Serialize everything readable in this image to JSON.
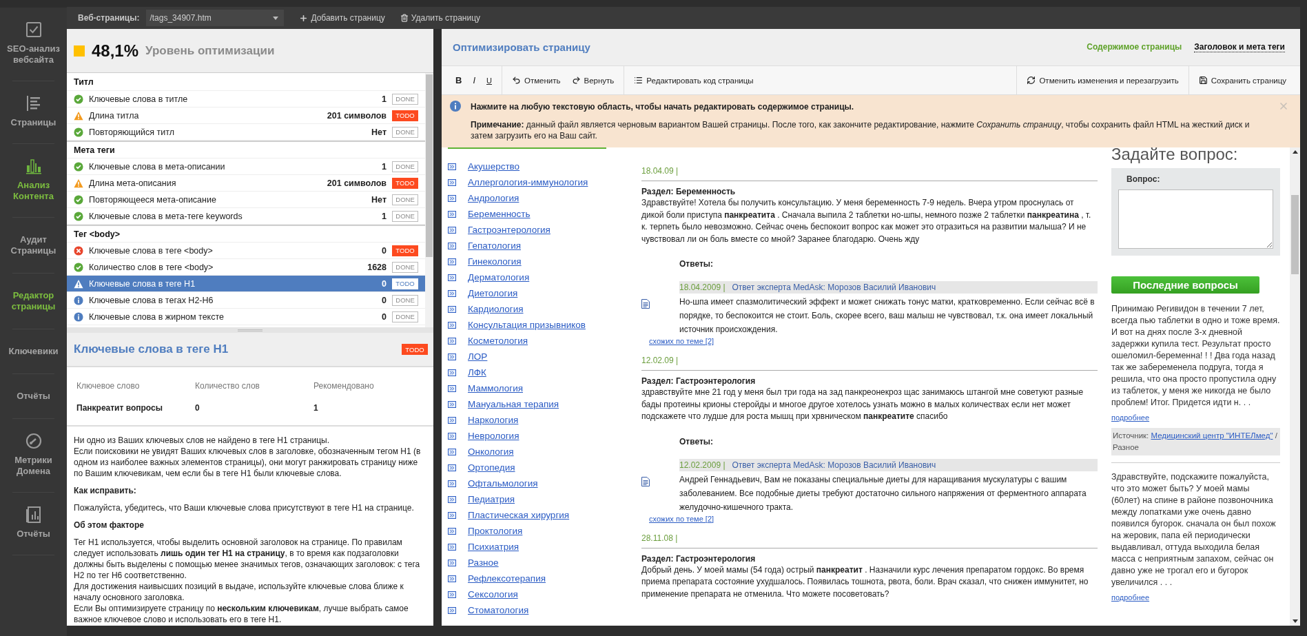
{
  "sidebar": {
    "items": [
      {
        "label": "SEO-анализ вебсайта",
        "kind": "check",
        "active": false
      },
      {
        "label": "Страницы",
        "kind": "list",
        "active": false
      },
      {
        "label": "Анализ Контента",
        "kind": "chart",
        "active": true
      },
      {
        "label": "Аудит Страницы",
        "active": false
      },
      {
        "label": "Редактор страницы",
        "active": true
      },
      {
        "label": "Ключевики",
        "active": false
      },
      {
        "label": "Отчёты",
        "active": false
      },
      {
        "label": "Метрики Домена",
        "kind": "gauge",
        "active": false
      },
      {
        "label": "Отчёты",
        "kind": "report",
        "active": false
      }
    ]
  },
  "topbar": {
    "label": "Веб-страницы:",
    "page_select": {
      "value": "/tags_34907.htm"
    },
    "buttons": [
      {
        "label": "Добавить страницу",
        "kind": "add"
      },
      {
        "label": "Удалить страницу",
        "kind": "delete"
      }
    ]
  },
  "score": {
    "value": "48,1%",
    "label": "Уровень оптимизации"
  },
  "factors": [
    {
      "title": "Титл",
      "rows": [
        {
          "label": "Ключевые слова в титле",
          "value": "1",
          "kind": "ok",
          "badge": "DONE",
          "resolved": true,
          "selected": false
        },
        {
          "label": "Длина титла",
          "value": "201 символов",
          "kind": "warning",
          "badge": "TODO",
          "resolved": false,
          "selected": false
        },
        {
          "label": "Повторяющийся титл",
          "value": "Нет",
          "kind": "ok",
          "badge": "DONE",
          "resolved": true,
          "selected": false
        }
      ]
    },
    {
      "title": "Мета теги",
      "rows": [
        {
          "label": "Ключевые слова в мета-описании",
          "value": "1",
          "kind": "ok",
          "badge": "DONE",
          "resolved": true,
          "selected": false
        },
        {
          "label": "Длина мета-описания",
          "value": "201 символов",
          "kind": "warning",
          "badge": "TODO",
          "resolved": false,
          "selected": false
        },
        {
          "label": "Повторяющееся мета-описание",
          "value": "Нет",
          "kind": "ok",
          "badge": "DONE",
          "resolved": true,
          "selected": false
        },
        {
          "label": "Ключевые слова в мета-теге keywords",
          "value": "1",
          "kind": "ok",
          "badge": "DONE",
          "resolved": true,
          "selected": false
        }
      ]
    },
    {
      "title": "Тег <body>",
      "rows": [
        {
          "label": "Ключевые слова в теге <body>",
          "value": "0",
          "kind": "error",
          "badge": "TODO",
          "resolved": false,
          "selected": false
        },
        {
          "label": "Количество слов в теге <body>",
          "value": "1628",
          "kind": "ok",
          "badge": "DONE",
          "resolved": true,
          "selected": false
        },
        {
          "label": "Ключевые слова в теге H1",
          "value": "0",
          "kind": "warning",
          "badge": "TODO",
          "resolved": false,
          "selected": true
        },
        {
          "label": "Ключевые слова в тегах H2-H6",
          "value": "0",
          "kind": "info",
          "badge": "DONE",
          "resolved": true,
          "selected": false
        },
        {
          "label": "Ключевые слова в жирном тексте",
          "value": "0",
          "kind": "info",
          "badge": "DONE",
          "resolved": true,
          "selected": false
        }
      ]
    }
  ],
  "detail": {
    "title": "Ключевые слова в теге H1",
    "badge": "TODO",
    "resolved": false,
    "columns": [
      "Ключевое слово",
      "Количество слов",
      "Рекомендовано"
    ],
    "rows": [
      [
        "Панкреатит вопросы",
        "0",
        "1"
      ]
    ],
    "blocks": [
      {
        "kind": "text",
        "lines": [
          "Ни одно из Ваших ключевых слов не найдено в теге H1 страницы.",
          "Если поисковики не увидят Ваших ключевых слов в заголовке, обозначенным тегом H1 (в одном из наиболее важных элементов страницы), они могут ранжировать страницу ниже по Вашим ключевикам, чем если бы в теге H1 были ключевые слова."
        ]
      },
      {
        "kind": "heading",
        "text": "Как исправить:"
      },
      {
        "kind": "text",
        "lines": [
          "Пожалуйста, убедитесь, что Ваши ключевые слова присутствуют в теге H1 на странице."
        ]
      },
      {
        "kind": "heading",
        "text": "Об этом факторе"
      },
      {
        "kind": "text",
        "lines": [
          "Тег H1 используется, чтобы выделить основной заголовок на странице. По правилам следует использовать **лишь один тег H1 на страницу**, в то время как подзаголовки должны быть выделены с помощью менее значимых тегов, означающих заголовок: с тега H2 по тег H6 соответственно.",
          "Для достижения наивысших позиций в выдаче, используйте ключевые слова ближе к началу основного заголовка.",
          "Если Вы оптимизируете страницу по **нескольким ключевикам**, лучше выбрать самое важное ключевое слово и использовать его в теге H1."
        ]
      }
    ]
  },
  "editor": {
    "title": "Оптимизировать страницу",
    "tabs": [
      {
        "label": "Содержимое страницы",
        "selected": true
      },
      {
        "label": "Заголовок и мета теги",
        "selected": false
      }
    ],
    "toolbar": {
      "left": [
        [
          {
            "label": "B",
            "kind": "bold"
          },
          {
            "label": "I",
            "kind": "italic"
          },
          {
            "label": "U",
            "kind": "underline"
          }
        ],
        [
          {
            "label": "Отменить",
            "kind": "undo"
          },
          {
            "label": "Вернуть",
            "kind": "redo"
          }
        ],
        [
          {
            "label": "Редактировать код страницы",
            "kind": "code"
          }
        ]
      ],
      "right": [
        [
          {
            "label": "Отменить изменения и перезагрузить",
            "kind": "reload"
          }
        ],
        [
          {
            "label": "Сохранить страницу",
            "kind": "save"
          }
        ]
      ]
    },
    "notice": {
      "headline": "Нажмите на любую текстовую область, чтобы начать редактировать содержимое страницы.",
      "note": "**Примечание:** данный файл является черновым вариантом Вашей страницы. После того, как закончите редактирование, нажмите *Сохранить страницу*, чтобы сохранить файл HTML на жесткий диск и затем загрузить его на Ваш сайт."
    },
    "preview": {
      "categories": [
        "Акушерство",
        "Аллергология-иммунология",
        "Андрология",
        "Беременность",
        "Гастроэнтерология",
        "Гепатология",
        "Гинекология",
        "Дерматология",
        "Диетология",
        "Кардиология",
        "Консультация призывников",
        "Косметология",
        "ЛОР",
        "ЛФК",
        "Маммология",
        "Мануальная терапия",
        "Наркология",
        "Неврология",
        "Онкология",
        "Ортопедия",
        "Офтальмология",
        "Педиатрия",
        "Пластическая хирургия",
        "Проктология",
        "Психиатрия",
        "Разное",
        "Рефлексотерапия",
        "Сексология",
        "Стоматология"
      ],
      "posts": [
        {
          "date": "18.04.09 |",
          "section": "Раздел: Беременность",
          "text": "Здравствуйте! Хотела бы получить консультацию. У меня беременность 7-9 недель. Вчера утром проснулась от дикой боли приступа **панкреатита** . Сначала выпила 2 таблетки но-шпы, немного позже 2 таблетки **панкреатина** , т. к. терпеть было невозможно. Сейчас очень беспокоит вопрос как может это отразиться на развитии малыша? И не чувствовал ли он боль вместе со мной? Заранее благодарю. Очень жду",
          "answers_label": "Ответы:",
          "answer": {
            "date": "18.04.2009 |",
            "author": "Ответ эксперта MedAsk: Морозов Василий Иванович",
            "text": "Но-шпа имеет спазмолитический эффект и может снижать тонус матки, кратковременно. Если сейчас всё в порядке, то беспокоится не стоит. Боль, скорее всего, ваш малыш не чувствовал, т.к. она имеет локальный источник происхождения.",
            "related": "схожих по теме [2]"
          }
        },
        {
          "date": "12.02.09 |",
          "section": "Раздел: Гастроэнтерология",
          "text": "здравствуйте мне 21 год у меня был три года на зад панкреонекроз щас занимаюсь штангой мне советуют разные бады протеины крионы стеройды и многое другое хотелось узнать можно в малых количествах если нет может подскажете что лудше для роста мышц при хрвническом **панкреатите** спасибо",
          "answers_label": "Ответы:",
          "answer": {
            "date": "12.02.2009 |",
            "author": "Ответ эксперта MedAsk: Морозов Василий Иванович",
            "text": "Андрей Геннадьевич, Вам не показаны специальные диеты для наращивания мускулатуры с вашим заболеванием. Все подобные диеты требуют достаточно сильного напряжения от ферментного аппарата желудочно-кишечного тракта.",
            "related": "схожих по теме [2]"
          }
        },
        {
          "date": "28.11.08 |",
          "section": "Раздел: Гастроэнтерология",
          "text": "Добрый день. У моей мамы (54 года) острый **панкреатит** . Назначили курс лечения препаратом гордокс. Во время приема препарата состояние ухудшалось. Появилась тошнота, рвота, боли. Врач сказал, что снижен иммунитет, но применение препарата не отменила. Что можете посоветовать?"
        }
      ],
      "ask": {
        "heading": "Задайте вопрос:",
        "label": "Вопрос:"
      },
      "latest": {
        "button": "Последние вопросы",
        "items": [
          {
            "text": "Принимаю Регивидон в течении 7 лет, всегда пью таблетки в одно и тоже время. И вот на днях после 3-х дневной задержки купила тест. Результат просто ошеломил-беременна! ! ! Два года назад так же забеременела подруга, тогда я решила, что она просто пропустила одну из таблеток, у меня же никогда не было проблем! Итог. Придется идти н. . .",
            "more": "подробнее",
            "source": {
              "label": "Источник:",
              "link": "Медицинский центр \"ИНТЕЛмед\"",
              "tail": "/Разное"
            }
          },
          {
            "text": "Здравствуйте, подскажите пожалуйста, что это может быть? У моей мамы (60лет) на спине в районе позвоночника между лопатками уже очень давно появился бугорок. сначала он был похож на жеровик, папа ей периодически выдавливал, оттуда выходила белая масса с неприятным запахом, сейчас он давно уже не трогал его и бугорок увеличился . . .",
            "more": "подробнее"
          }
        ]
      }
    }
  }
}
